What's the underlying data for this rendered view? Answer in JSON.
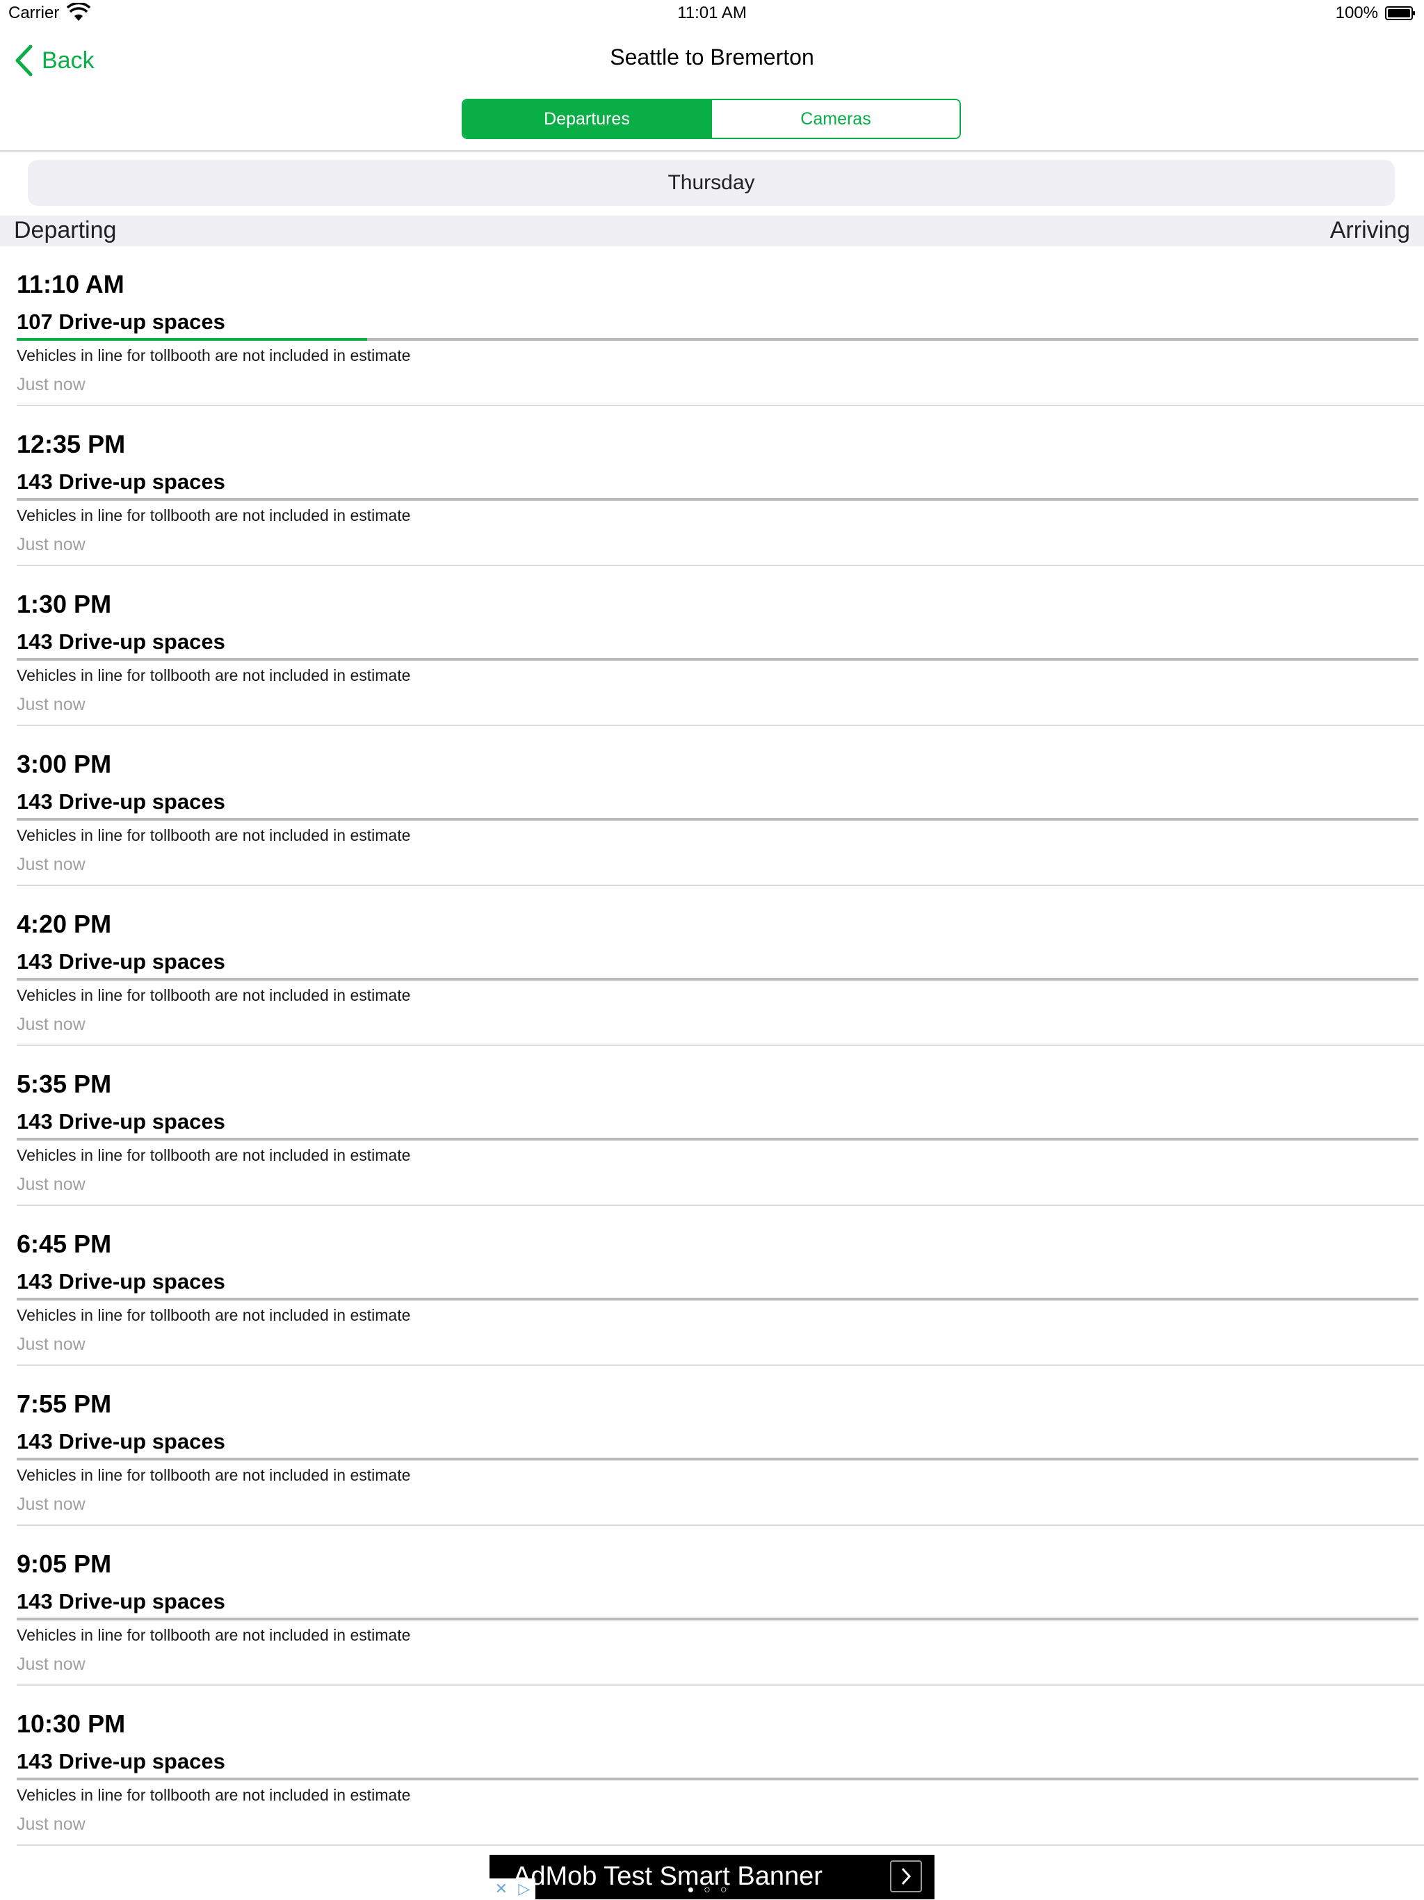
{
  "status_bar": {
    "carrier": "Carrier",
    "time": "11:01 AM",
    "battery": "100%"
  },
  "nav": {
    "back_label": "Back",
    "title": "Seattle to Bremerton"
  },
  "segments": [
    {
      "label": "Departures",
      "active": true
    },
    {
      "label": "Cameras",
      "active": false
    }
  ],
  "day": "Thursday",
  "columns": {
    "left": "Departing",
    "right": "Arriving"
  },
  "sailings": [
    {
      "time": "11:10 AM",
      "spaces": "107 Drive-up spaces",
      "note": "Vehicles in line for tollbooth are not included in estimate",
      "updated": "Just now",
      "fill_fraction": 0.25
    },
    {
      "time": "12:35 PM",
      "spaces": "143 Drive-up spaces",
      "note": "Vehicles in line for tollbooth are not included in estimate",
      "updated": "Just now",
      "fill_fraction": 0
    },
    {
      "time": "1:30 PM",
      "spaces": "143 Drive-up spaces",
      "note": "Vehicles in line for tollbooth are not included in estimate",
      "updated": "Just now",
      "fill_fraction": 0
    },
    {
      "time": "3:00 PM",
      "spaces": "143 Drive-up spaces",
      "note": "Vehicles in line for tollbooth are not included in estimate",
      "updated": "Just now",
      "fill_fraction": 0
    },
    {
      "time": "4:20 PM",
      "spaces": "143 Drive-up spaces",
      "note": "Vehicles in line for tollbooth are not included in estimate",
      "updated": "Just now",
      "fill_fraction": 0
    },
    {
      "time": "5:35 PM",
      "spaces": "143 Drive-up spaces",
      "note": "Vehicles in line for tollbooth are not included in estimate",
      "updated": "Just now",
      "fill_fraction": 0
    },
    {
      "time": "6:45 PM",
      "spaces": "143 Drive-up spaces",
      "note": "Vehicles in line for tollbooth are not included in estimate",
      "updated": "Just now",
      "fill_fraction": 0
    },
    {
      "time": "7:55 PM",
      "spaces": "143 Drive-up spaces",
      "note": "Vehicles in line for tollbooth are not included in estimate",
      "updated": "Just now",
      "fill_fraction": 0
    },
    {
      "time": "9:05 PM",
      "spaces": "143 Drive-up spaces",
      "note": "Vehicles in line for tollbooth are not included in estimate",
      "updated": "Just now",
      "fill_fraction": 0
    },
    {
      "time": "10:30 PM",
      "spaces": "143 Drive-up spaces",
      "note": "Vehicles in line for tollbooth are not included in estimate",
      "updated": "Just now",
      "fill_fraction": 0
    }
  ],
  "ad": {
    "text": "AdMob Test Smart Banner",
    "dots": "●○○"
  },
  "colors": {
    "accent": "#0aae46",
    "bar_track": "#b9b9b9",
    "muted": "#a0a0a0",
    "group_bg": "#efeff4"
  },
  "icons": {
    "wifi": "wifi-icon",
    "battery": "battery-icon",
    "back": "chevron-left-icon",
    "ad_arrow": "chevron-right-icon"
  }
}
